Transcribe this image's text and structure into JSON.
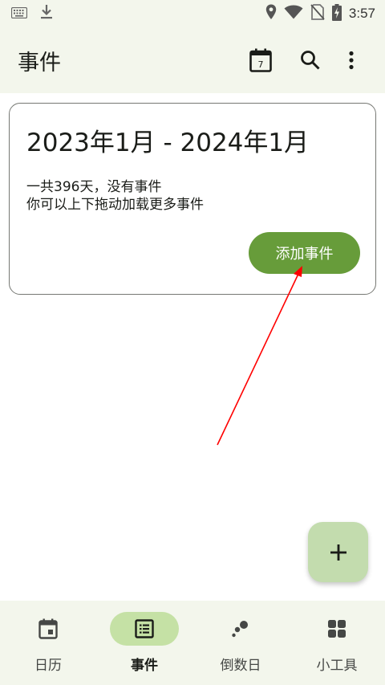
{
  "status_bar": {
    "time": "3:57",
    "left_icons": [
      "keyboard-icon",
      "download-icon"
    ],
    "right_icons": [
      "location-icon",
      "wifi-icon",
      "no-sim-icon",
      "battery-charging-icon"
    ]
  },
  "app_bar": {
    "title": "事件",
    "calendar_day": "7",
    "actions": [
      "calendar-today-icon",
      "search-icon",
      "more-vert-icon"
    ]
  },
  "card": {
    "title": "2023年1月 - 2024年1月",
    "line1": "一共396天，没有事件",
    "line2": "你可以上下拖动加载更多事件",
    "button_label": "添加事件"
  },
  "fab": {
    "icon": "plus-icon"
  },
  "bottom_nav": {
    "items": [
      {
        "label": "日历",
        "icon": "calendar-icon",
        "active": false
      },
      {
        "label": "事件",
        "icon": "list-icon",
        "active": true
      },
      {
        "label": "倒数日",
        "icon": "bubbles-icon",
        "active": false
      },
      {
        "label": "小工具",
        "icon": "widgets-icon",
        "active": false
      }
    ]
  },
  "colors": {
    "bar_background": "#f3f6ec",
    "button_green": "#679c3a",
    "fab_green": "#c3dcae",
    "nav_active_pill": "#c5e1a5",
    "annotation_arrow": "#ff0000"
  }
}
